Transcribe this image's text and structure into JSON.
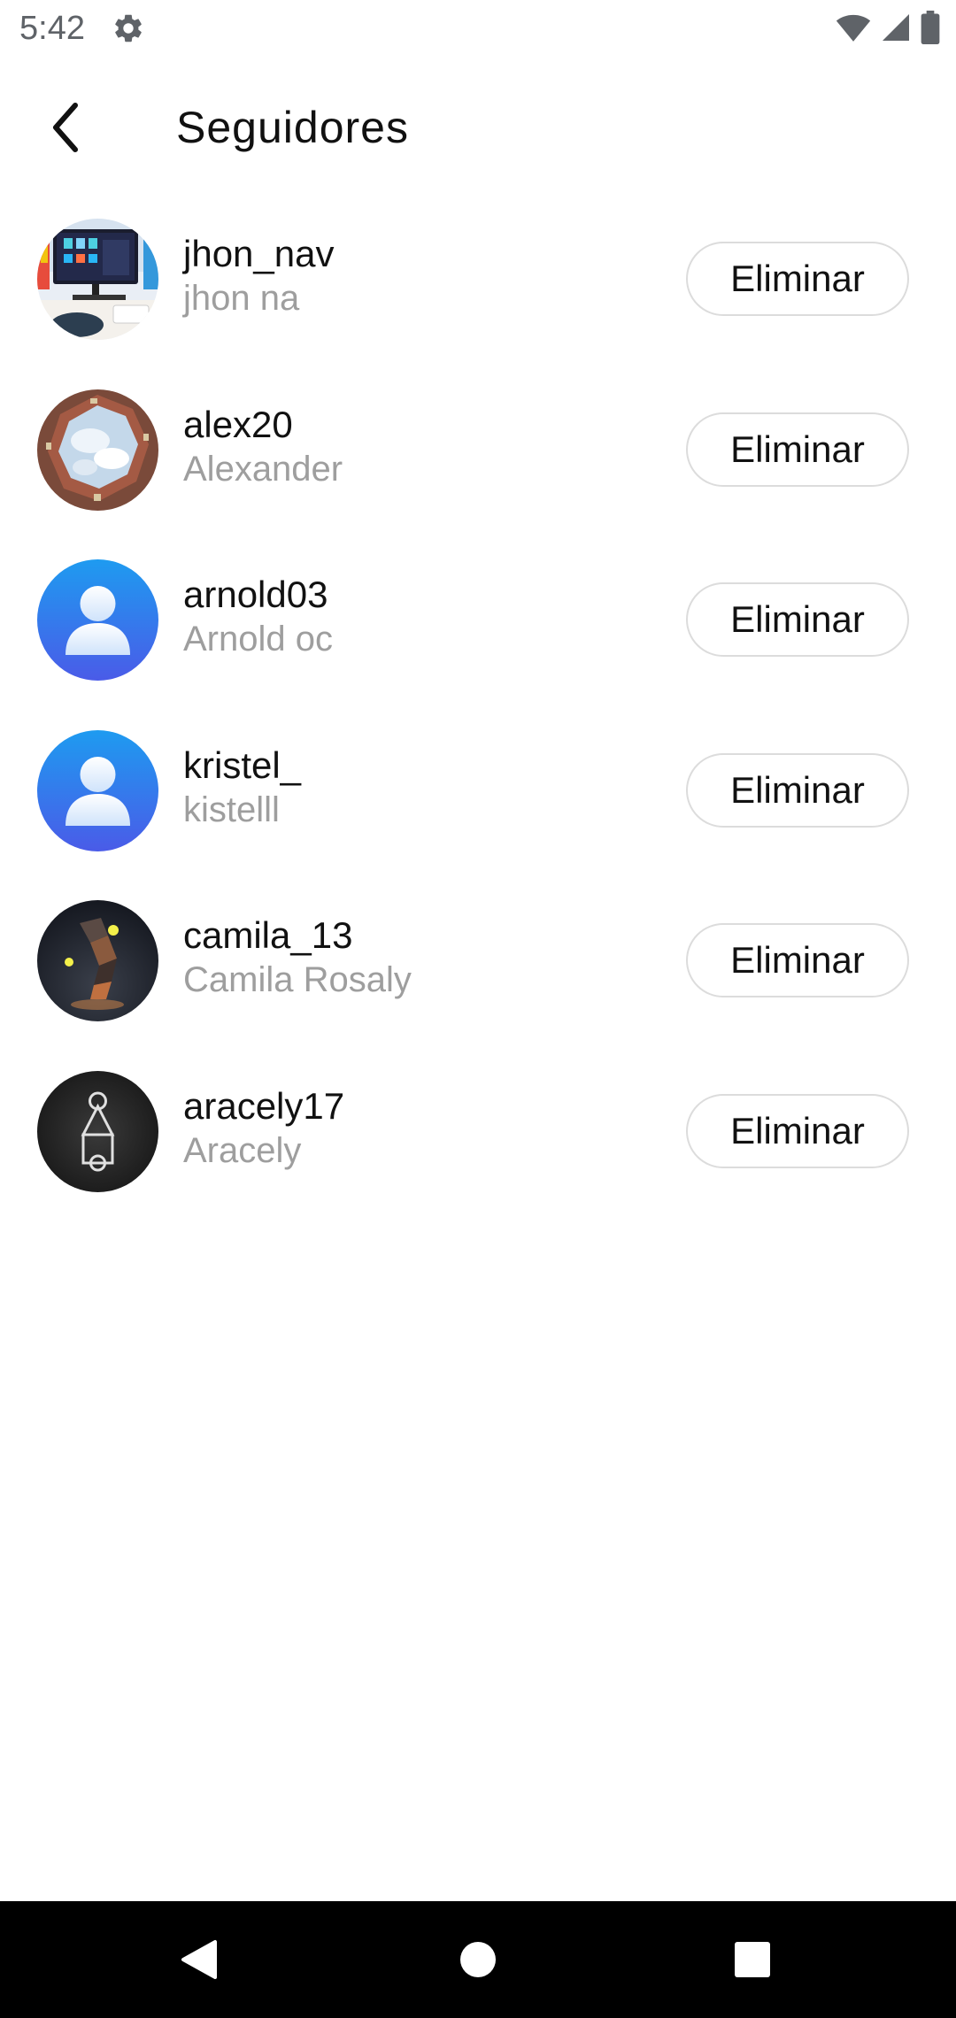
{
  "status_bar": {
    "time": "5:42",
    "icons": [
      "settings-icon",
      "wifi-icon",
      "signal-icon",
      "battery-icon"
    ]
  },
  "toolbar": {
    "back_icon": "chevron-left-icon",
    "title": "Seguidores"
  },
  "followers": [
    {
      "username": "jhon_nav",
      "fullname": "jhon na",
      "button_label": "Eliminar",
      "avatar": "photo-desk-setup"
    },
    {
      "username": "alex20",
      "fullname": "Alexander",
      "button_label": "Eliminar",
      "avatar": "photo-courtyard-sky"
    },
    {
      "username": "arnold03",
      "fullname": "Arnold oc",
      "button_label": "Eliminar",
      "avatar": "default-person-avatar"
    },
    {
      "username": "kristel_",
      "fullname": "kistelll",
      "button_label": "Eliminar",
      "avatar": "default-person-avatar"
    },
    {
      "username": "camila_13",
      "fullname": "Camila Rosaly",
      "button_label": "Eliminar",
      "avatar": "photo-dark-abstract"
    },
    {
      "username": "aracely17",
      "fullname": "Aracely",
      "button_label": "Eliminar",
      "avatar": "photo-shapes-symbol"
    }
  ],
  "nav_bar": {
    "icons": [
      "nav-back-icon",
      "nav-home-icon",
      "nav-recents-icon"
    ]
  },
  "colors": {
    "title_text": "#111111",
    "secondary_text": "#9e9e9e",
    "button_border": "#dcdcdc",
    "avatar_blue": "#2f7cf0",
    "nav_bar_bg": "#000000"
  }
}
